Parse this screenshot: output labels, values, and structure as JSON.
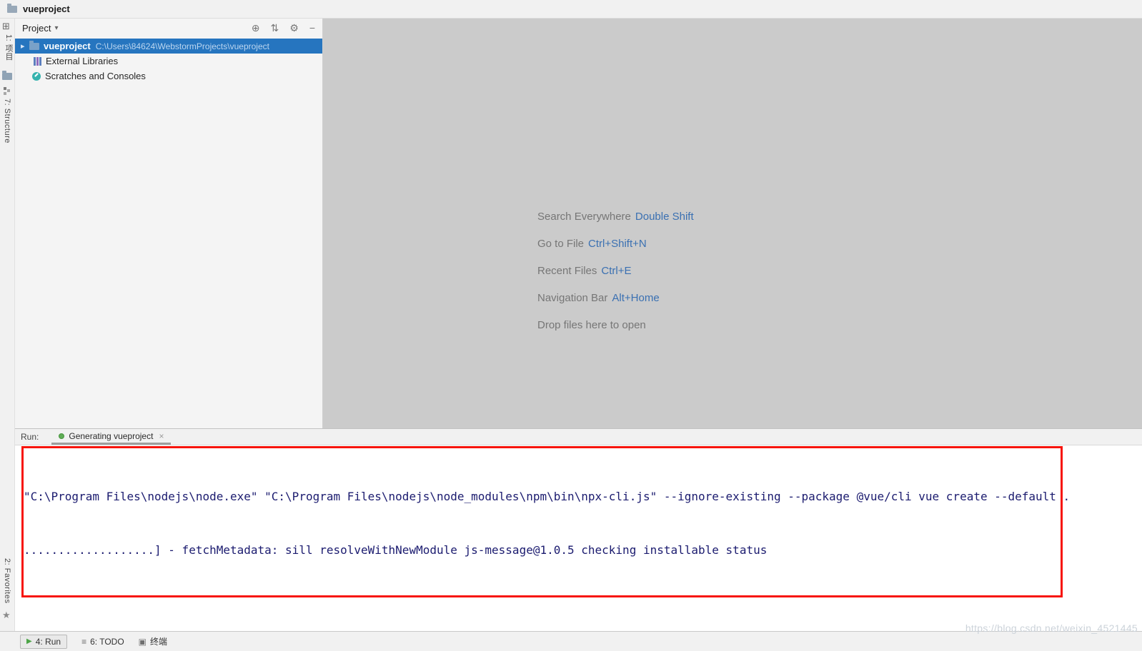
{
  "titlebar": {
    "title": "vueproject"
  },
  "stripe": {
    "project": "1: 项目",
    "structure": "7: Structure",
    "favorites": "2: Favorites"
  },
  "project_panel": {
    "header_title": "Project",
    "tree": [
      {
        "name": "vueproject",
        "path": "C:\\Users\\84624\\WebstormProjects\\vueproject",
        "selected": true
      },
      {
        "name": "External Libraries"
      },
      {
        "name": "Scratches and Consoles"
      }
    ]
  },
  "editor_hints": {
    "rows": [
      {
        "label": "Search Everywhere",
        "shortcut": "Double Shift"
      },
      {
        "label": "Go to File",
        "shortcut": "Ctrl+Shift+N"
      },
      {
        "label": "Recent Files",
        "shortcut": "Ctrl+E"
      },
      {
        "label": "Navigation Bar",
        "shortcut": "Alt+Home"
      },
      {
        "label": "Drop files here to open",
        "shortcut": ""
      }
    ]
  },
  "run_panel": {
    "label": "Run:",
    "tab_title": "Generating vueproject",
    "console_lines": [
      "\"C:\\Program Files\\nodejs\\node.exe\" \"C:\\Program Files\\nodejs\\node_modules\\npm\\bin\\npx-cli.js\" --ignore-existing --package @vue/cli vue create --default .",
      "...................] - fetchMetadata: sill resolveWithNewModule js-message@1.0.5 checking installable status"
    ]
  },
  "status_bar": {
    "run": "4: Run",
    "todo": "6: TODO",
    "terminal": "终端"
  },
  "watermark": "https://blog.csdn.net/weixin_4521445",
  "icons": {
    "project_window": "⊞",
    "header_caret": "▾",
    "locate": "⊕",
    "collapse": "⇅",
    "gear": "⚙",
    "hide": "−",
    "tree_caret": "▸",
    "star": "★",
    "close": "×",
    "run_play": "▶",
    "todo_list": "≡",
    "terminal": "▣"
  },
  "colors": {
    "selection_blue": "#2675bf",
    "shortcut_blue": "#3a70b2",
    "annotation_red": "#f7140a",
    "console_text": "#1b1b6f"
  }
}
